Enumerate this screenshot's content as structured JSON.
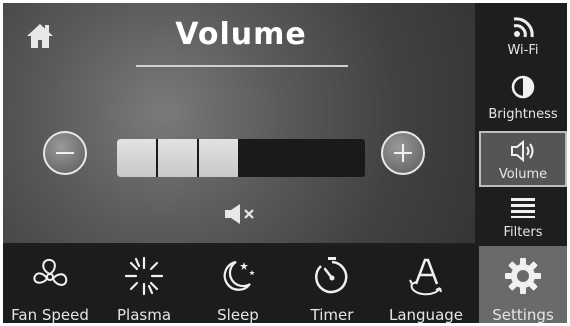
{
  "header": {
    "title": "Volume"
  },
  "volume": {
    "level": 3,
    "max": 6
  },
  "sidebar": {
    "items": [
      {
        "label": "Wi-Fi",
        "icon": "wifi-icon"
      },
      {
        "label": "Brightness",
        "icon": "brightness-icon"
      },
      {
        "label": "Volume",
        "icon": "speaker-icon",
        "active": true
      },
      {
        "label": "Filters",
        "icon": "filters-icon"
      }
    ]
  },
  "bottom_nav": {
    "items": [
      {
        "label": "Fan Speed",
        "icon": "fan-icon"
      },
      {
        "label": "Plasma",
        "icon": "plasma-icon"
      },
      {
        "label": "Sleep",
        "icon": "moon-stars-icon"
      },
      {
        "label": "Timer",
        "icon": "timer-icon"
      },
      {
        "label": "Language",
        "icon": "language-icon"
      },
      {
        "label": "Settings",
        "icon": "gear-icon"
      }
    ]
  }
}
